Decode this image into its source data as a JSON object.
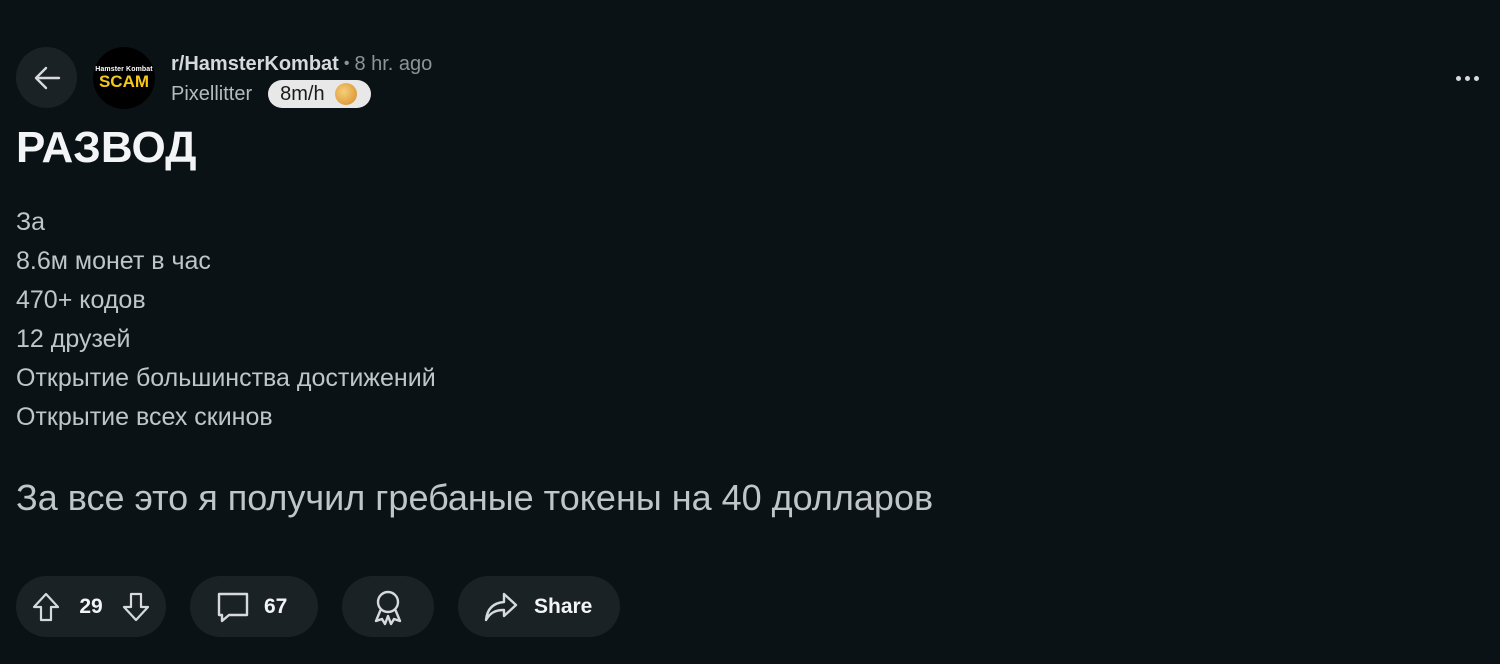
{
  "header": {
    "back_icon": "arrow-left-icon",
    "avatar_small_text": "Hamster Kombat",
    "avatar_big_text": "SCAM",
    "subreddit": "r/HamsterKombat",
    "separator": "•",
    "time": "8 hr. ago",
    "username": "Pixellitter",
    "flair_text": "8m/h",
    "flair_icon": "coin-icon",
    "more_icon": "more-dots-icon"
  },
  "post": {
    "title": "РАЗВОД",
    "lines": [
      "За",
      "8.6м монет в час",
      "470+ кодов",
      "12 друзей",
      "Открытие большинства достижений",
      "Открытие всех скинов"
    ],
    "emphasis": "За все это я получил гребаные токены на 40 долларов"
  },
  "actions": {
    "upvote_icon": "arrow-up-icon",
    "score": "29",
    "downvote_icon": "arrow-down-icon",
    "comment_icon": "comment-icon",
    "comment_count": "67",
    "award_icon": "award-icon",
    "share_icon": "share-arrow-icon",
    "share_label": "Share"
  }
}
